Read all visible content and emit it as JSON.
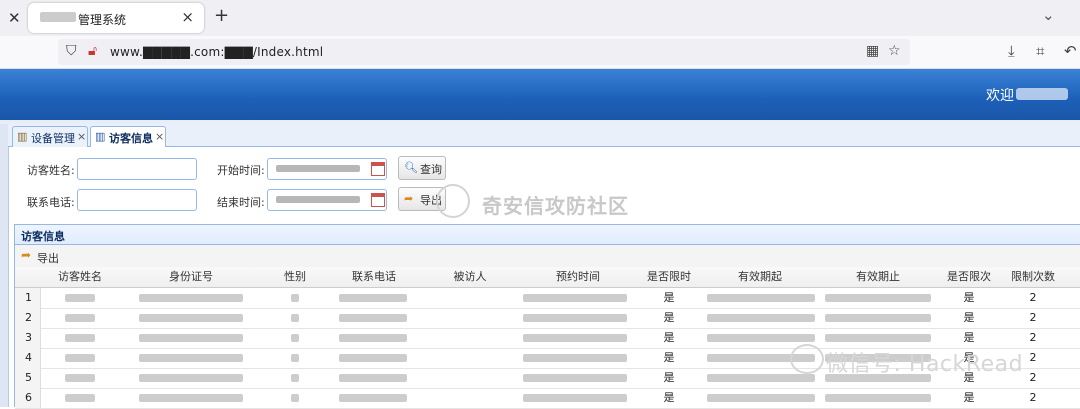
{
  "browser": {
    "tab_title": "管理系统",
    "close_glyph": "×",
    "new_tab_glyph": "+",
    "url": "www.▇▇▇▇▇.com:▇▇▇/Index.html"
  },
  "header": {
    "welcome": "欢迎"
  },
  "app_tabs": [
    {
      "label": "设备管理",
      "close": "×"
    },
    {
      "label": "访客信息",
      "close": "×"
    }
  ],
  "search": {
    "visitor_name_label": "访客姓名:",
    "phone_label": "联系电话:",
    "start_label": "开始时间:",
    "end_label": "结束时间:",
    "query_button": "查询",
    "export_button": "导出"
  },
  "panel": {
    "title": "访客信息",
    "toolbar_export": "导出"
  },
  "table": {
    "columns": [
      "访客姓名",
      "身份证号",
      "性别",
      "联系电话",
      "被访人",
      "预约时间",
      "是否限时",
      "有效期起",
      "有效期止",
      "是否限次",
      "限制次数"
    ],
    "rows": [
      {
        "n": "1",
        "limited_time": "是",
        "limited_count": "是",
        "count": "2"
      },
      {
        "n": "2",
        "limited_time": "是",
        "limited_count": "是",
        "count": "2"
      },
      {
        "n": "3",
        "limited_time": "是",
        "limited_count": "是",
        "count": "2"
      },
      {
        "n": "4",
        "limited_time": "是",
        "limited_count": "是",
        "count": "2"
      },
      {
        "n": "5",
        "limited_time": "是",
        "limited_count": "是",
        "count": "2"
      },
      {
        "n": "6",
        "limited_time": "是",
        "limited_count": "是",
        "count": "2"
      }
    ]
  },
  "watermarks": {
    "center": "奇安信攻防社区",
    "bottom": "微信号: HackRead"
  },
  "colors": {
    "header_blue": "#1d5fb8",
    "border_blue": "#95b8e7"
  }
}
